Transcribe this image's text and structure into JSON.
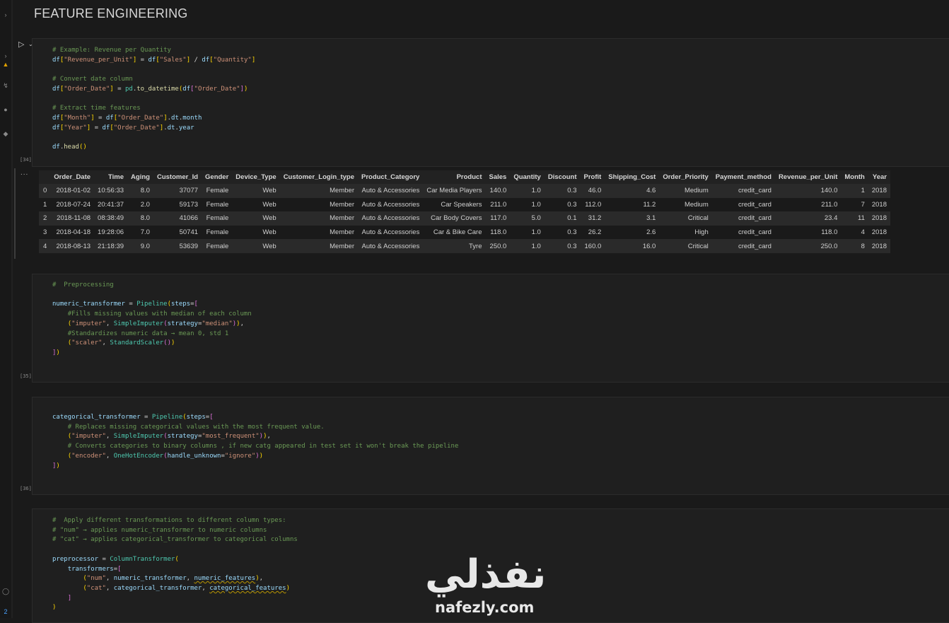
{
  "notebook": {
    "heading": "FEATURE ENGINEERING",
    "cells": [
      {
        "exec_count": "[34]"
      },
      {
        "exec_count": "[35]"
      },
      {
        "exec_count": "[36]"
      }
    ],
    "output_menu": "..."
  },
  "dataframe": {
    "columns": [
      "",
      "Order_Date",
      "Time",
      "Aging",
      "Customer_Id",
      "Gender",
      "Device_Type",
      "Customer_Login_type",
      "Product_Category",
      "Product",
      "Sales",
      "Quantity",
      "Discount",
      "Profit",
      "Shipping_Cost",
      "Order_Priority",
      "Payment_method",
      "Revenue_per_Unit",
      "Month",
      "Year"
    ],
    "rows": [
      [
        "0",
        "2018-01-02",
        "10:56:33",
        "8.0",
        "37077",
        "Female",
        "Web",
        "Member",
        "Auto & Accessories",
        "Car Media Players",
        "140.0",
        "1.0",
        "0.3",
        "46.0",
        "4.6",
        "Medium",
        "credit_card",
        "140.0",
        "1",
        "2018"
      ],
      [
        "1",
        "2018-07-24",
        "20:41:37",
        "2.0",
        "59173",
        "Female",
        "Web",
        "Member",
        "Auto & Accessories",
        "Car Speakers",
        "211.0",
        "1.0",
        "0.3",
        "112.0",
        "11.2",
        "Medium",
        "credit_card",
        "211.0",
        "7",
        "2018"
      ],
      [
        "2",
        "2018-11-08",
        "08:38:49",
        "8.0",
        "41066",
        "Female",
        "Web",
        "Member",
        "Auto & Accessories",
        "Car Body Covers",
        "117.0",
        "5.0",
        "0.1",
        "31.2",
        "3.1",
        "Critical",
        "credit_card",
        "23.4",
        "11",
        "2018"
      ],
      [
        "3",
        "2018-04-18",
        "19:28:06",
        "7.0",
        "50741",
        "Female",
        "Web",
        "Member",
        "Auto & Accessories",
        "Car & Bike Care",
        "118.0",
        "1.0",
        "0.3",
        "26.2",
        "2.6",
        "High",
        "credit_card",
        "118.0",
        "4",
        "2018"
      ],
      [
        "4",
        "2018-08-13",
        "21:18:39",
        "9.0",
        "53639",
        "Female",
        "Web",
        "Member",
        "Auto & Accessories",
        "Tyre",
        "250.0",
        "1.0",
        "0.3",
        "160.0",
        "16.0",
        "Critical",
        "credit_card",
        "250.0",
        "8",
        "2018"
      ]
    ]
  },
  "watermark": {
    "arabic": "نفذلي",
    "latin": "nafezly.com"
  },
  "icons": [
    "run-icon",
    "chevron-down-icon",
    "more-icon",
    "warning-icon"
  ],
  "colors": {
    "background": "#1a1a1a",
    "cell": "#1f1f1f",
    "comment": "#6a9955",
    "string": "#ce9178",
    "function": "#dcdcaa",
    "class": "#4ec9b0",
    "variable": "#9cdcfe",
    "bracket": "#ffd700"
  }
}
